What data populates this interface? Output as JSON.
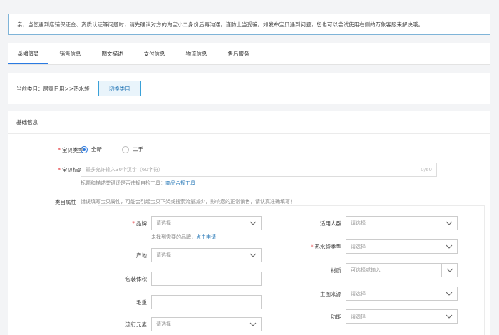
{
  "notice": {
    "text": "亲，当您遇到店铺保证金、资质认证等问题时，请先确认对方的淘宝小二身份后再沟通，谨防上当受骗。如发布宝贝遇到问题，您也可以尝试使用右侧的万象客服来解决哦。"
  },
  "tabs": [
    {
      "label": "基础信息",
      "active": true
    },
    {
      "label": "销售信息",
      "active": false
    },
    {
      "label": "图文描述",
      "active": false
    },
    {
      "label": "支付信息",
      "active": false
    },
    {
      "label": "物流信息",
      "active": false
    },
    {
      "label": "售后服务",
      "active": false
    }
  ],
  "category": {
    "label": "当前类目：居家日用>>热水袋",
    "switch_button": "切换类目"
  },
  "basic_info": {
    "section_title": "基础信息",
    "item_type": {
      "label": "宝贝类型",
      "options": [
        {
          "label": "全新",
          "checked": true
        },
        {
          "label": "二手",
          "checked": false
        }
      ]
    },
    "item_title": {
      "label": "宝贝标题",
      "placeholder": "最多允许输入30个汉字（60字符）",
      "counter": "0/60",
      "hint": "标题和描述关键词是否违规自检工具：",
      "hint_link": "商品合规工具"
    },
    "attributes": {
      "label": "类目属性",
      "hint": "错误填写宝贝属性，可能会引起宝贝下架或搜索流量减少，影响您的正常销售，请认真准确填写！",
      "brand": {
        "label": "品牌",
        "placeholder": "请选择",
        "hint": "未找到需要的品牌，",
        "hint_link": "点击申请"
      },
      "origin": {
        "label": "产地",
        "placeholder": "请选择"
      },
      "package_volume": {
        "label": "包装体积"
      },
      "gross_weight": {
        "label": "毛重"
      },
      "style": {
        "label": "流行元素",
        "placeholder": "请选择"
      },
      "audience": {
        "label": "适用人群",
        "placeholder": "请选择"
      },
      "bag_type": {
        "label": "热水袋类型",
        "placeholder": "请选择"
      },
      "material": {
        "label": "材质",
        "placeholder": "可选择或输入"
      },
      "pattern_source": {
        "label": "主图来源",
        "placeholder": "请选择"
      },
      "function": {
        "label": "功能",
        "placeholder": "请选择"
      }
    }
  }
}
